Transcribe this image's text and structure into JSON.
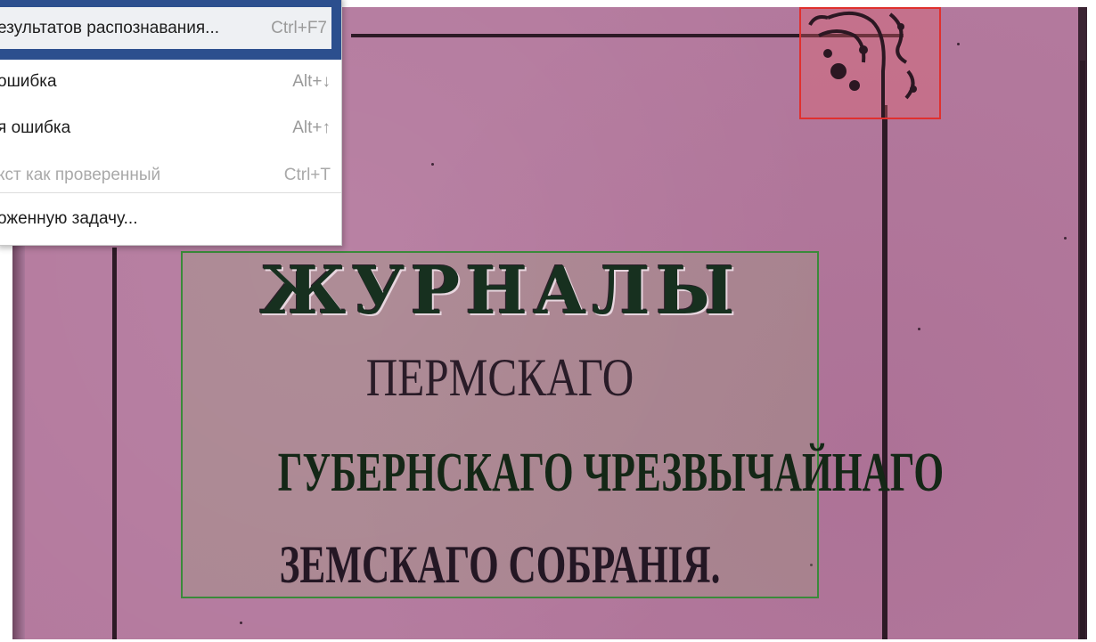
{
  "context_menu": {
    "items": [
      {
        "label": "езультатов распознавания...",
        "shortcut": "Ctrl+F7",
        "state": "highlighted"
      },
      {
        "label": "ошибка",
        "shortcut": "Alt+↓",
        "state": "enabled"
      },
      {
        "label": "я ошибка",
        "shortcut": "Alt+↑",
        "state": "enabled"
      },
      {
        "label": "кст как проверенный",
        "shortcut": "Ctrl+T",
        "state": "disabled"
      },
      {
        "label": "оженную задачу...",
        "shortcut": "",
        "state": "enabled"
      }
    ]
  },
  "document": {
    "text_lines": [
      "ЖУРНАЛЫ",
      "ПЕРМСКАГО",
      "ГУБЕРНСКАГО   ЧРЕЗВЫЧАЙНАГО",
      "ЗЕМСКАГО   СОБРАНІЯ."
    ]
  },
  "colors": {
    "page_background": "#b47a9e",
    "text_block_border": "#3a8a3a",
    "picture_block_border": "#e0302e",
    "menu_highlight_frame": "#2c4f8e"
  }
}
